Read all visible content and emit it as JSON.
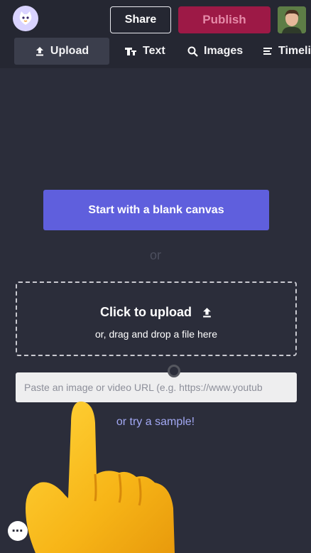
{
  "header": {
    "share_label": "Share",
    "publish_label": "Publish"
  },
  "tabs": [
    {
      "label": "Upload",
      "icon": "upload-icon",
      "active": true
    },
    {
      "label": "Text",
      "icon": "text-icon"
    },
    {
      "label": "Images",
      "icon": "search-icon"
    },
    {
      "label": "Timeli",
      "icon": "timeline-icon"
    }
  ],
  "main": {
    "blank_canvas_label": "Start with a blank canvas",
    "or_label": "or",
    "upload_title": "Click to upload",
    "upload_subtitle": "or, drag and drop a file here",
    "url_placeholder": "Paste an image or video URL (e.g. https://www.youtub",
    "sample_link": "or try a sample!"
  },
  "colors": {
    "background": "#2b2d3a",
    "topbar": "#252732",
    "accent": "#5f5fdd",
    "publish": "#9d1946",
    "link": "#a2a8f3"
  }
}
